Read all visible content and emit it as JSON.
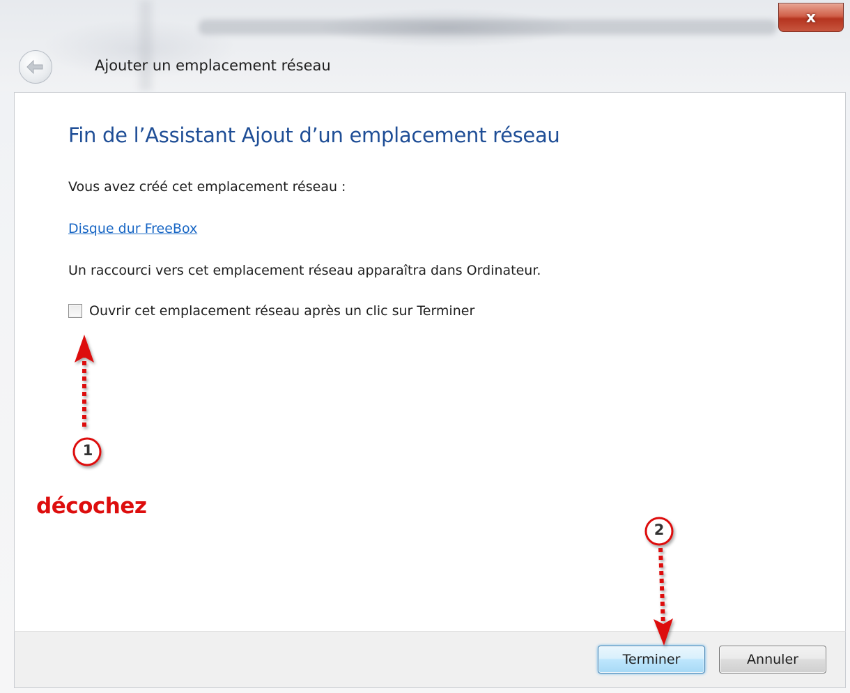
{
  "window": {
    "close_glyph": "x",
    "back_icon": "back-arrow-icon",
    "nav_title": "Ajouter un emplacement réseau"
  },
  "main": {
    "heading": "Fin de l’Assistant Ajout d’un emplacement réseau",
    "created_text": "Vous avez créé cet emplacement réseau :",
    "location_link": "Disque dur FreeBox",
    "shortcut_text": "Un raccourci vers cet emplacement réseau apparaîtra dans Ordinateur.",
    "open_checkbox": {
      "label": "Ouvrir cet emplacement réseau après un clic sur Terminer",
      "checked": false
    }
  },
  "footer": {
    "finish_label": "Terminer",
    "cancel_label": "Annuler"
  },
  "annotations": {
    "step1_number": "1",
    "step2_number": "2",
    "step1_word": "décochez",
    "color": "#dd0d0d"
  },
  "colors": {
    "heading": "#1f4e96",
    "link": "#1866c4"
  }
}
